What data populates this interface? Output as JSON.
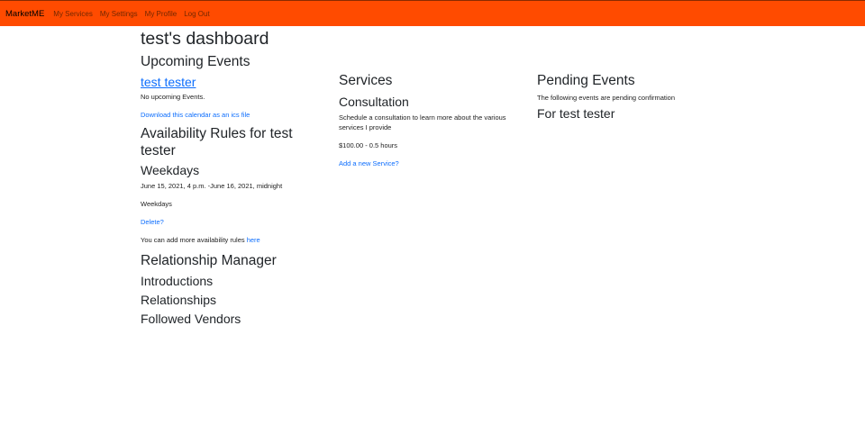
{
  "nav": {
    "brand": "MarketME",
    "links": [
      "My Services",
      "My Settings",
      "My Profile",
      "Log Out"
    ]
  },
  "dashboard": {
    "title": "test's dashboard",
    "upcoming_events": {
      "heading": "Upcoming Events",
      "user_link": "test tester",
      "none_text": "No upcoming Events.",
      "calendar_link": "Download this calendar as an ics file"
    },
    "availability": {
      "heading": "Availability Rules for test tester",
      "rule_title": "Weekdays",
      "rule_time": "June 15, 2021, 4 p.m. -June 16, 2021, midnight",
      "rule_days": "Weekdays",
      "delete_link": "Delete?",
      "add_more_prefix": "You can add more availability rules",
      "add_more_link": "here"
    },
    "relationship_manager": {
      "heading": "Relationship Manager",
      "items": [
        "Introductions",
        "Relationships",
        "Followed Vendors"
      ]
    },
    "services": {
      "heading": "Services",
      "service_title": "Consultation",
      "service_desc": "Schedule a consultation to learn more about the various services I provide",
      "service_price": "$100.00 - 0.5 hours",
      "add_link": "Add a new Service?"
    },
    "pending_events": {
      "heading": "Pending Events",
      "desc": "The following events are pending confirmation",
      "for_user": "For test tester"
    }
  },
  "colors": {
    "navbar": "#ff4b00",
    "link": "#0d6efd"
  }
}
